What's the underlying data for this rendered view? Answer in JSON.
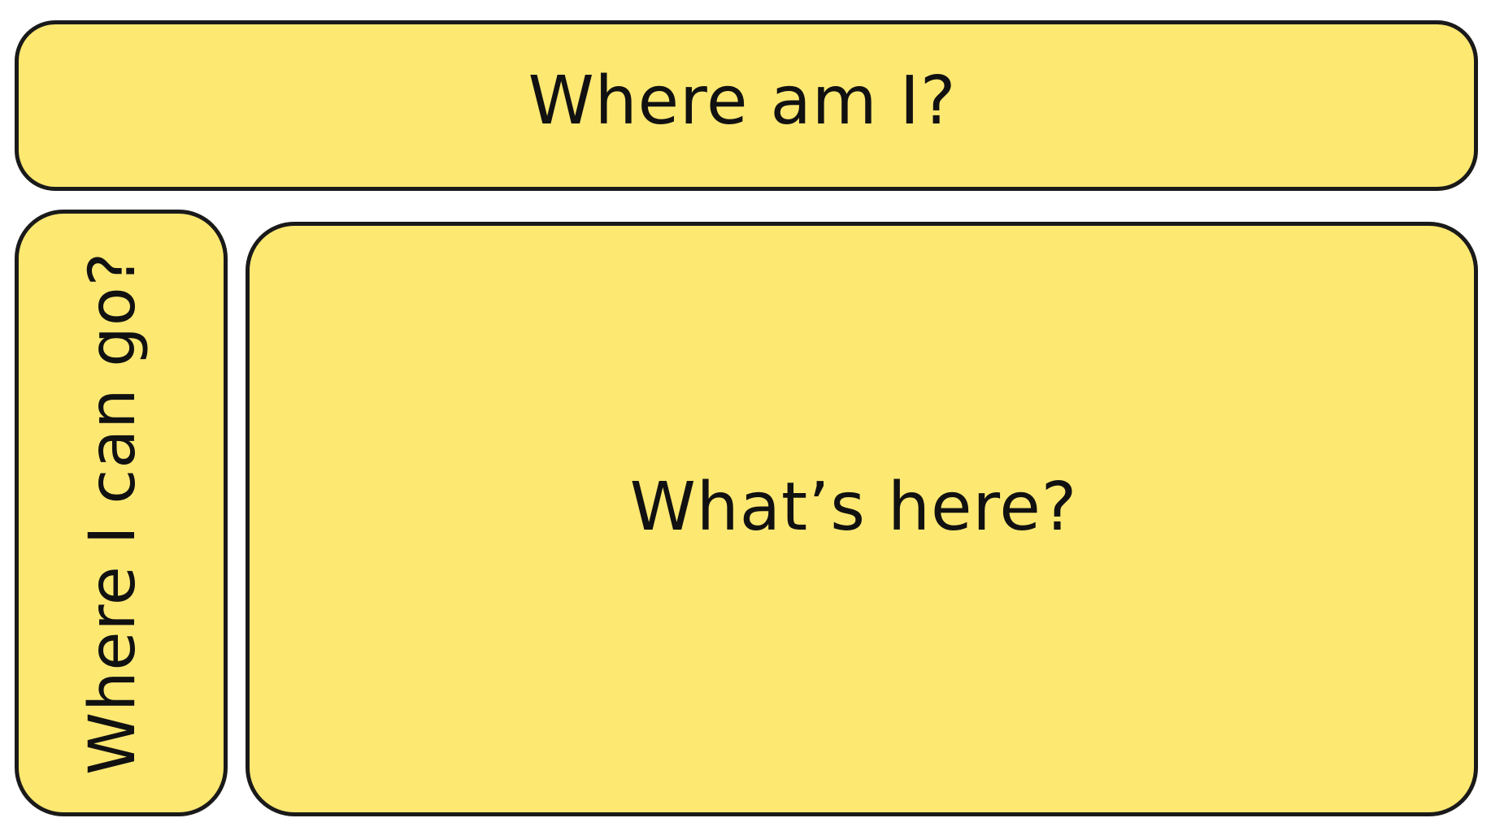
{
  "regions": {
    "top": {
      "label": "Where am I?"
    },
    "side": {
      "label": "Where I can go?"
    },
    "main": {
      "label": "What’s here?"
    }
  },
  "colors": {
    "box_fill": "#FDE872",
    "box_border": "#1a1a1a",
    "text": "#111111",
    "background": "#ffffff"
  }
}
